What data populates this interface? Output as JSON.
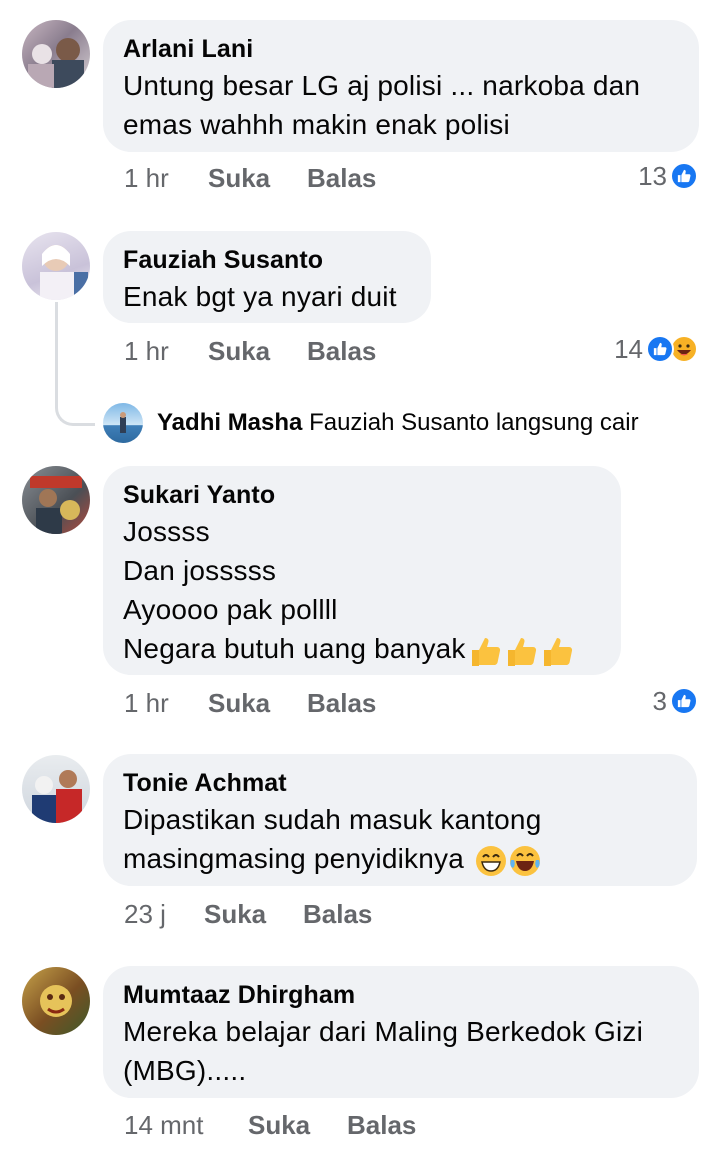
{
  "colors": {
    "like_blue": "#1877f2",
    "bubble_bg": "#f0f2f5",
    "meta_gray": "#65676b",
    "haha_yellow": "#f7b125"
  },
  "comments": [
    {
      "author": "Arlani Lani",
      "text": "Untung besar LG aj polisi ... narkoba dan\nemas wahhh makin enak polisi",
      "time": "1 hr",
      "like_label": "Suka",
      "reply_label": "Balas",
      "reaction_count": "13",
      "reaction_icons": [
        "like-icon"
      ]
    },
    {
      "author": "Fauziah Susanto",
      "text": "Enak bgt ya nyari duit",
      "time": "1 hr",
      "like_label": "Suka",
      "reply_label": "Balas",
      "reaction_count": "14",
      "reaction_icons": [
        "like-icon",
        "haha-icon"
      ],
      "reply_preview": {
        "author": "Yadhi Masha",
        "text": "Fauziah Susanto langsung cair"
      }
    },
    {
      "author": "Sukari Yanto",
      "text": "Jossss\nDan joss​sss\nAyoooo pak pollll\nNegara butuh uang banyak",
      "emoji": [
        "thumbs-up-icon",
        "thumbs-up-icon",
        "thumbs-up-icon"
      ],
      "time": "1 hr",
      "like_label": "Suka",
      "reply_label": "Balas",
      "reaction_count": "3",
      "reaction_icons": [
        "like-icon"
      ]
    },
    {
      "author": "Tonie Achmat",
      "text": "Dipastikan sudah masuk kantong\nmasingmasing penyidiknya ",
      "emoji": [
        "grin-icon",
        "tears-of-joy-icon"
      ],
      "time": "23 j",
      "like_label": "Suka",
      "reply_label": "Balas"
    },
    {
      "author": "Mumtaaz Dhirgham",
      "text": "Mereka belajar dari Maling Berkedok Gizi\n(MBG).....",
      "time": "14 mnt",
      "like_label": "Suka",
      "reply_label": "Balas"
    }
  ]
}
